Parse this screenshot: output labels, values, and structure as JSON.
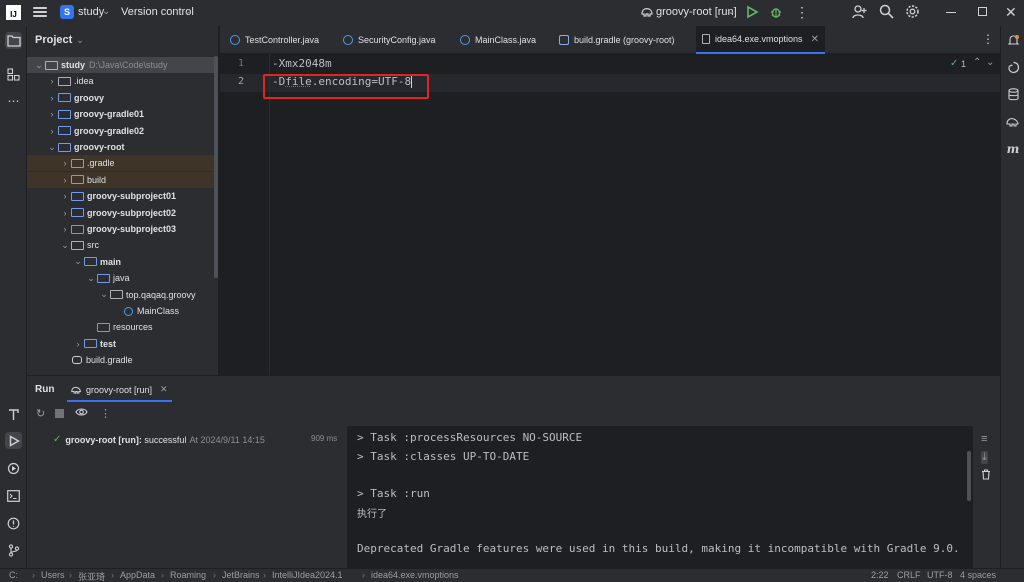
{
  "titlebar": {
    "project_badge": "S",
    "project_name": "study",
    "version_control": "Version control",
    "run_config": "groovy-root [run]"
  },
  "project_panel": {
    "title": "Project",
    "tree": [
      {
        "label": "study",
        "path": "D:\\Java\\Code\\study",
        "bold": true,
        "level": 0,
        "expanded": true,
        "selected": true
      },
      {
        "label": ".idea",
        "level": 1,
        "expanded": false
      },
      {
        "label": "groovy",
        "bold": true,
        "level": 1,
        "expanded": false
      },
      {
        "label": "groovy-gradle01",
        "bold": true,
        "level": 1,
        "expanded": false
      },
      {
        "label": "groovy-gradle02",
        "bold": true,
        "level": 1,
        "expanded": false
      },
      {
        "label": "groovy-root",
        "bold": true,
        "level": 1,
        "expanded": true
      },
      {
        "label": ".gradle",
        "level": 2,
        "expanded": false,
        "excluded": true
      },
      {
        "label": "build",
        "level": 2,
        "expanded": false,
        "excluded": true
      },
      {
        "label": "groovy-subproject01",
        "bold": true,
        "level": 2,
        "expanded": false
      },
      {
        "label": "groovy-subproject02",
        "bold": true,
        "level": 2,
        "expanded": false
      },
      {
        "label": "groovy-subproject03",
        "bold": true,
        "level": 2,
        "expanded": false
      },
      {
        "label": "src",
        "level": 2,
        "expanded": true
      },
      {
        "label": "main",
        "bold": true,
        "level": 3,
        "expanded": true
      },
      {
        "label": "java",
        "level": 4,
        "expanded": true
      },
      {
        "label": "top.qaqaq.groovy",
        "level": 5,
        "expanded": true
      },
      {
        "label": "MainClass",
        "level": 6,
        "leaf": true
      },
      {
        "label": "resources",
        "level": 4,
        "leaf": true
      },
      {
        "label": "test",
        "bold": true,
        "level": 3,
        "expanded": false
      },
      {
        "label": "build.gradle",
        "level": 2,
        "leaf": true
      }
    ]
  },
  "tabs": [
    {
      "label": "TestController.java"
    },
    {
      "label": "SecurityConfig.java"
    },
    {
      "label": "MainClass.java"
    },
    {
      "label": "build.gradle (groovy-root)"
    },
    {
      "label": "idea64.exe.vmoptions",
      "active": true
    }
  ],
  "editor": {
    "lines": [
      {
        "num": "1",
        "text": "-Xmx2048m"
      },
      {
        "num": "2",
        "text_a": "-D",
        "text_b": "file",
        "text_c": ".encoding=UTF-8"
      }
    ],
    "inspection_count": "1"
  },
  "run_panel": {
    "title": "Run",
    "tab_label": "groovy-root [run]",
    "result": {
      "name": "groovy-root [run]:",
      "status": "successful",
      "at": "At 2024/9/11 14:15",
      "duration": "909 ms"
    },
    "console": [
      "> Task :processResources NO-SOURCE",
      "> Task :classes UP-TO-DATE",
      "",
      "> Task :run",
      "执行了",
      "",
      "Deprecated Gradle features were used in this build, making it incompatible with Gradle 9.0."
    ]
  },
  "statusbar": {
    "breadcrumbs": [
      "C:",
      "Users",
      "张亚琦",
      "AppData",
      "Roaming",
      "JetBrains",
      "IntelliJIdea2024.1",
      "idea64.exe.vmoptions"
    ],
    "position": "2:22",
    "line_sep": "CRLF",
    "encoding": "UTF-8",
    "indent": "4 spaces"
  }
}
